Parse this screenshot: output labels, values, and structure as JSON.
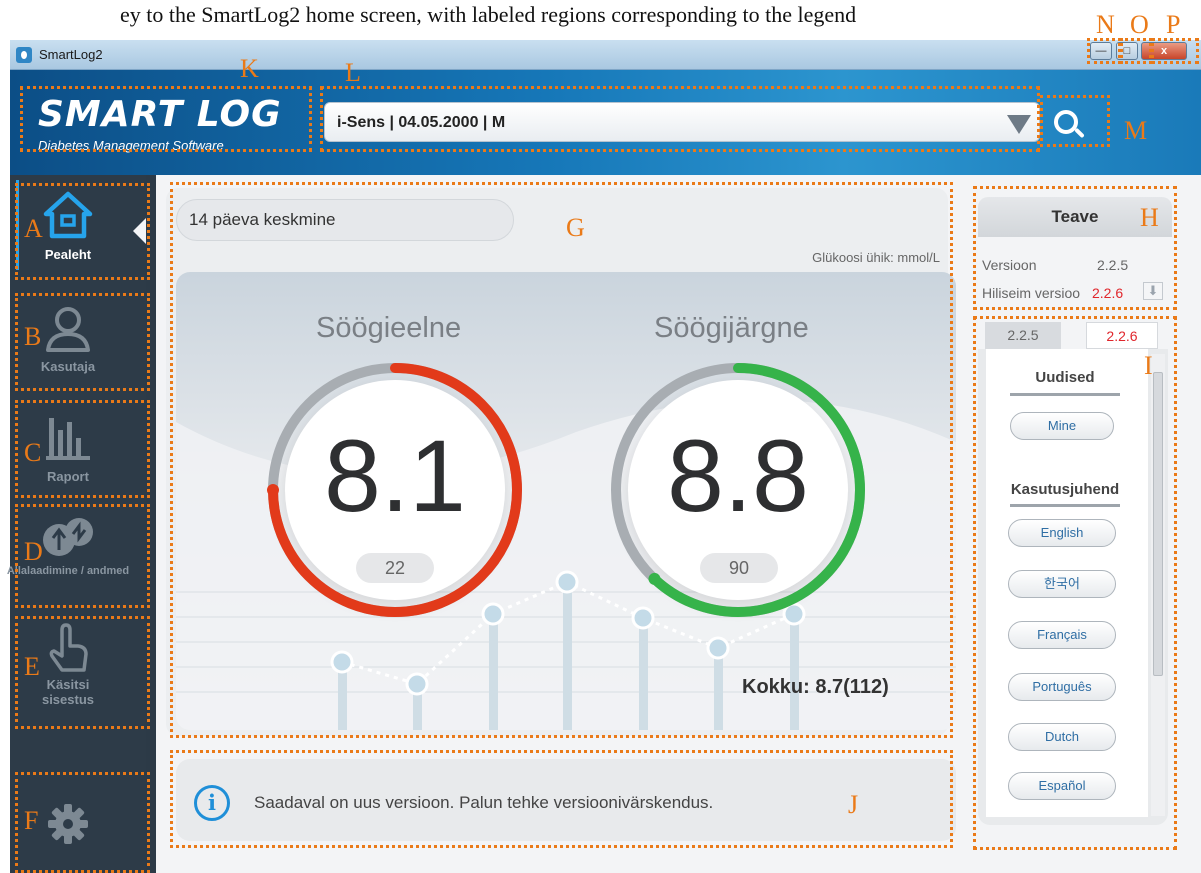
{
  "caption": {
    "text": "ey to the SmartLog2 home screen, with labeled regions corresponding to the legend"
  },
  "window": {
    "title": "SmartLog2",
    "controls": {
      "minimize": "—",
      "maximize": "□",
      "close": "x"
    }
  },
  "header": {
    "logo_main": "SMART LOG",
    "logo_sub": "Diabetes Management Software",
    "device_select_value": "i-Sens | 04.05.2000 | M"
  },
  "sidebar": {
    "items": [
      {
        "label": "Pealeht",
        "icon": "home-icon",
        "active": true
      },
      {
        "label": "Kasutaja",
        "icon": "user-icon"
      },
      {
        "label": "Raport",
        "icon": "bar-chart-icon"
      },
      {
        "label": "Allalaadimine / andmed",
        "icon": "usb-sync-icon"
      },
      {
        "label": "Käsitsi sisestus",
        "icon": "hand-pointer-icon"
      },
      {
        "label": "",
        "icon": "gear-icon"
      }
    ]
  },
  "summary": {
    "period_label": "14 päeva keskmine",
    "unit_label": "Glükoosi ühik: mmol/L",
    "before_meal": {
      "title": "Söögieelne",
      "value": "8.1",
      "count": "22",
      "arc_fraction": 0.75,
      "color": "#e23a1a"
    },
    "after_meal": {
      "title": "Söögijärgne",
      "value": "8.8",
      "count": "90",
      "arc_fraction": 0.62,
      "color": "#36b34a"
    },
    "total": "Kokku: 8.7(112)"
  },
  "notice": {
    "text": "Saadaval on uus versioon. Palun tehke versioonivärskendus."
  },
  "info": {
    "title": "Teave",
    "version_label": "Versioon",
    "version_value": "2.2.5",
    "latest_label": "Hiliseim versioo",
    "latest_value": "2.2.6"
  },
  "docs": {
    "tabs": [
      "2.2.5",
      "2.2.6"
    ],
    "news_heading": "Uudised",
    "news_button": "Mine",
    "manual_heading": "Kasutusjuhend",
    "languages": [
      "English",
      "한국어",
      "Français",
      "Português",
      "Dutch",
      "Español"
    ]
  },
  "callouts": {
    "A": "A",
    "B": "B",
    "C": "C",
    "D": "D",
    "E": "E",
    "F": "F",
    "G": "G",
    "H": "H",
    "I": "I",
    "J": "J",
    "K": "K",
    "L": "L",
    "M": "M",
    "N": "N",
    "O": "O",
    "P": "P"
  },
  "colors": {
    "accent_blue": "#1f8fd8",
    "sidebar": "#2d3b48",
    "annotation_orange": "#ea7a18",
    "version_red": "#e0262c"
  }
}
